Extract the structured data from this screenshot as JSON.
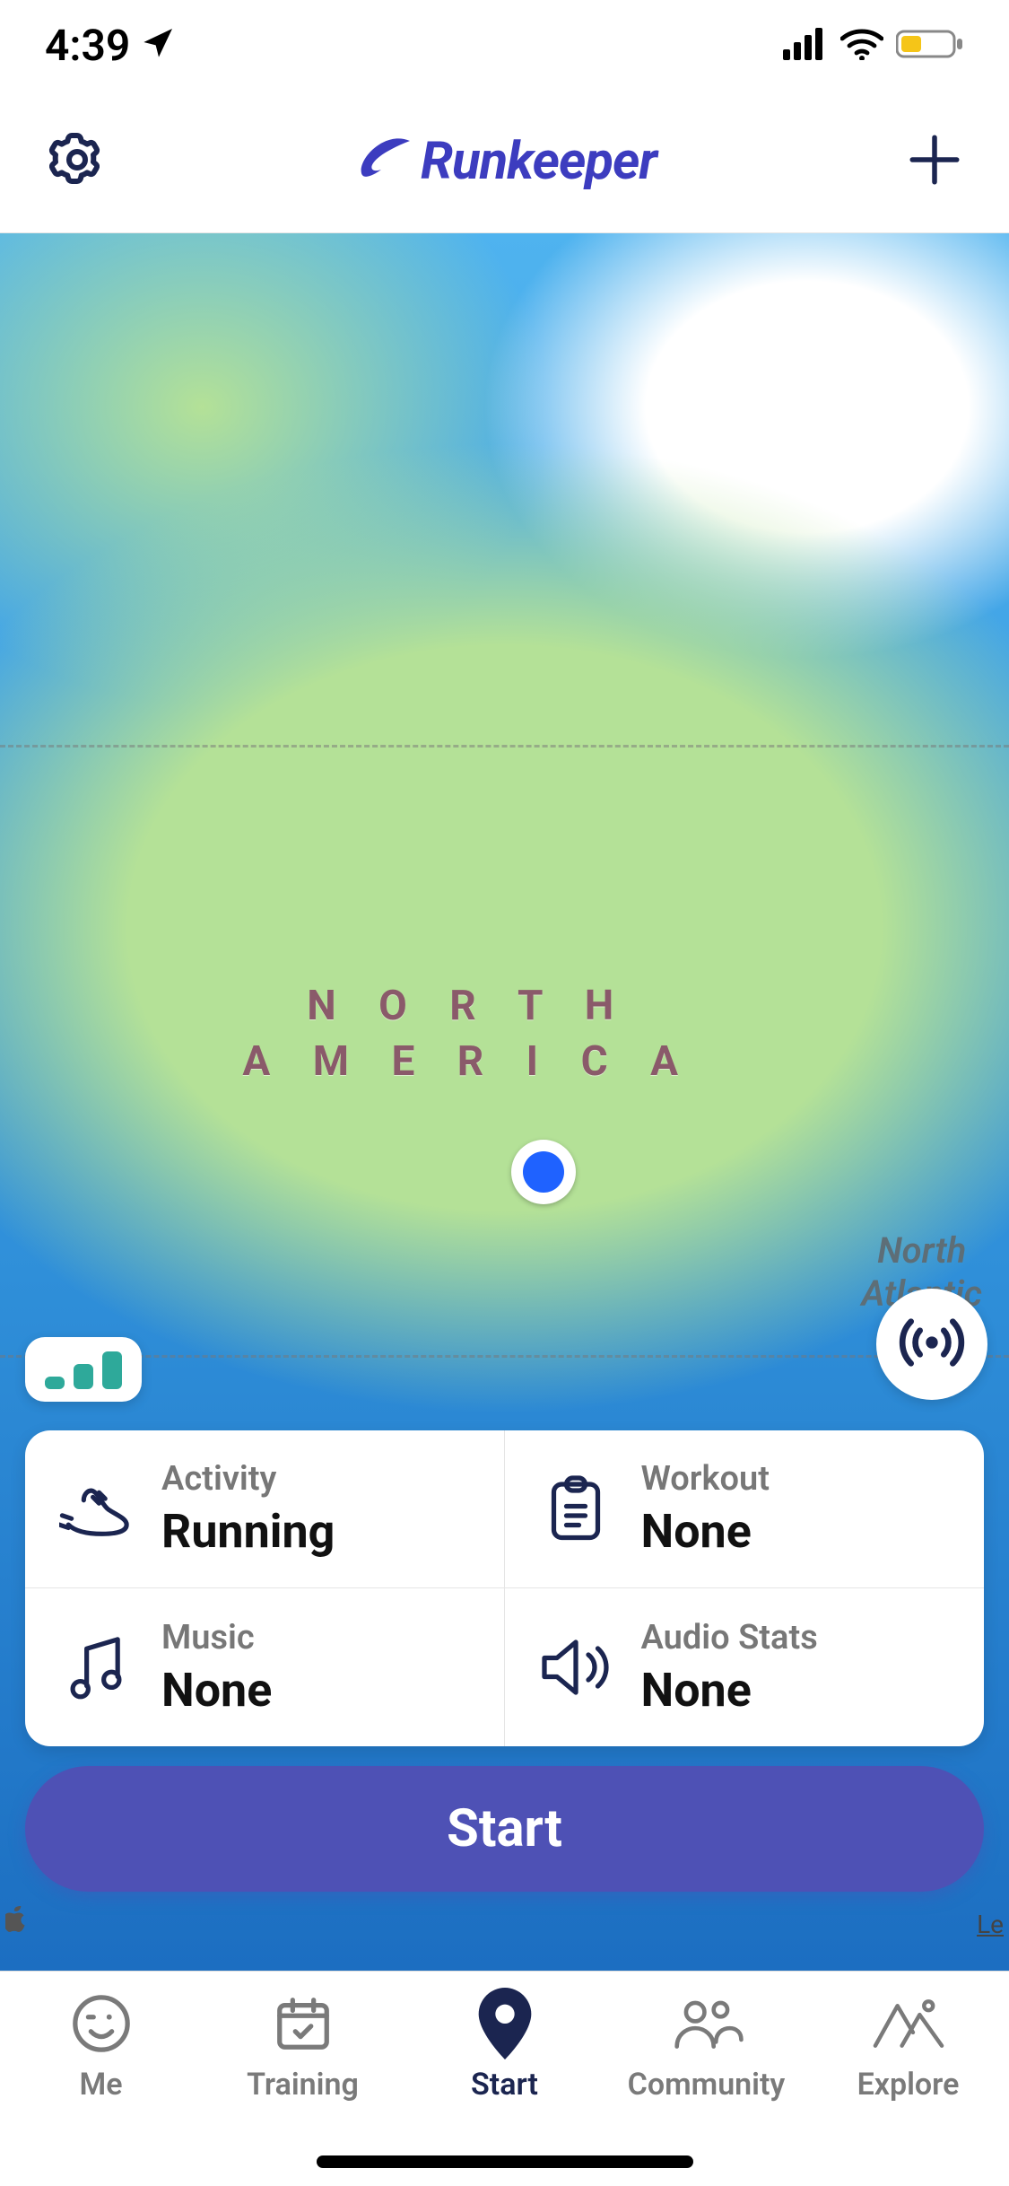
{
  "status": {
    "time": "4:39"
  },
  "header": {
    "brand": "Runkeeper"
  },
  "map": {
    "continent_label_line1": "N O R T H",
    "continent_label_line2": "A M E R I C A",
    "ocean_label_line1": "North",
    "ocean_label_line2": "Atlantic",
    "attribution_legal": "Le"
  },
  "options": {
    "activity": {
      "label": "Activity",
      "value": "Running"
    },
    "workout": {
      "label": "Workout",
      "value": "None"
    },
    "music": {
      "label": "Music",
      "value": "None"
    },
    "audio": {
      "label": "Audio Stats",
      "value": "None"
    }
  },
  "start_button": {
    "label": "Start"
  },
  "tabs": {
    "me": {
      "label": "Me"
    },
    "training": {
      "label": "Training"
    },
    "start": {
      "label": "Start"
    },
    "community": {
      "label": "Community"
    },
    "explore": {
      "label": "Explore"
    }
  }
}
